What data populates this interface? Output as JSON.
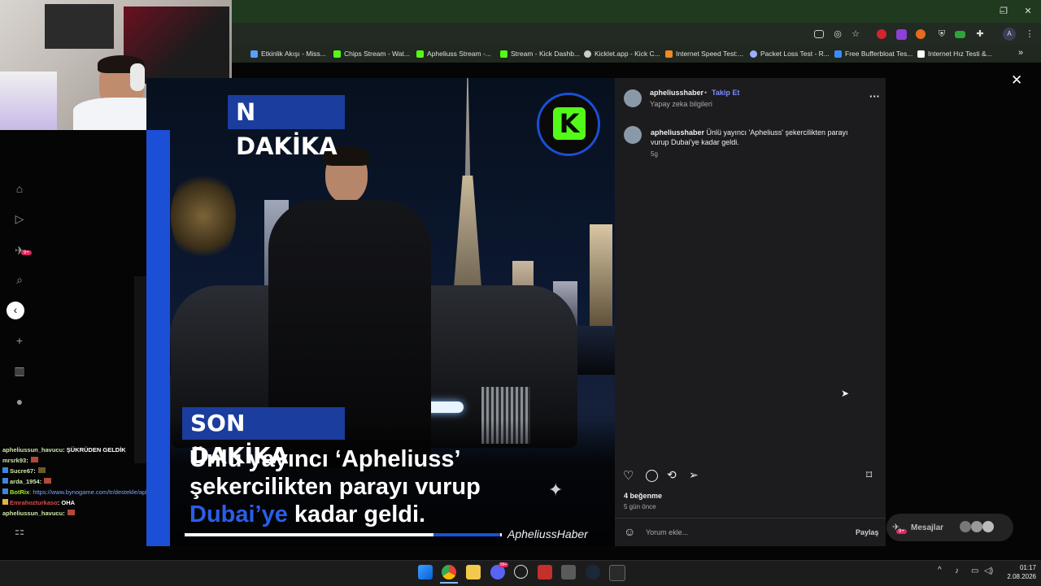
{
  "browser": {
    "bookmarks": [
      {
        "label": "Etkinlik Akışı - Miss...",
        "color": "#5aa0ff"
      },
      {
        "label": "Chips Stream - Wat...",
        "color": "#53fc18"
      },
      {
        "label": "Apheliuss Stream -...",
        "color": "#53fc18"
      },
      {
        "label": "Stream - Kick Dashb...",
        "color": "#53fc18"
      },
      {
        "label": "Kicklet.app - Kick C...",
        "color": "#cccccc"
      },
      {
        "label": "Internet Speed Test:...",
        "color": "#f08a24"
      },
      {
        "label": "Packet Loss Test - R...",
        "color": "#9ab0ff"
      },
      {
        "label": "Free Bufferbloat Tes...",
        "color": "#3c8cff"
      },
      {
        "label": "Internet Hız Testi &...",
        "color": "#ffffff"
      }
    ],
    "bookmarks_more": "»",
    "profile_initial": "A",
    "win_minimize": "–",
    "win_maximize": "❐",
    "win_close": "✕"
  },
  "chat": {
    "lines": [
      {
        "user": "apheliussun_havucu",
        "text": ": ŞÜKRÜDEN GELDİK"
      },
      {
        "user": "mrsrk93",
        "text": ":"
      },
      {
        "user": "Sucre67",
        "text": ":"
      },
      {
        "user": "arda_1954",
        "text": ":"
      },
      {
        "user": "BotRix",
        "text": ": https://www.bynogame.com/tr/destekle/apheliuss3"
      },
      {
        "user": "Emrahozturkaso",
        "text": ": OHA"
      },
      {
        "user": "apheliussun_havucu",
        "text": ":"
      }
    ]
  },
  "nav": {
    "notification_badge": "9+"
  },
  "post": {
    "headline_top": "N DAKİKA",
    "badge": "SON DAKİKA",
    "line1": "Ünlü yayıncı ‘Apheliuss’",
    "line2": "şekercilikten parayı vurup",
    "line3_highlight": "Dubai’ye",
    "line3_rest": " kadar geldi.",
    "watermark": "ApheliussHaber",
    "kick_logo": "K"
  },
  "sidepanel": {
    "username": "apheliusshaber",
    "separator": "•",
    "follow": "Takip Et",
    "subtitle": "Yapay zeka bilgileri",
    "more": "···",
    "caption_user": "apheliusshaber",
    "caption_text": " Ünlü yayıncı 'Apheliuss' şekercilikten parayı vurup Dubai'ye kadar geldi.",
    "caption_time": "5g",
    "likes": "4 beğenme",
    "post_time": "5 gün önce",
    "comment_placeholder": "Yorum ekle...",
    "share": "Paylaş",
    "messages": "Mesajlar",
    "messages_badge": "9+"
  },
  "close_label": "✕",
  "taskbar": {
    "time": "01:17",
    "date": "2.08.2026",
    "discord_badge": "99+",
    "tray_chevron": "^"
  }
}
